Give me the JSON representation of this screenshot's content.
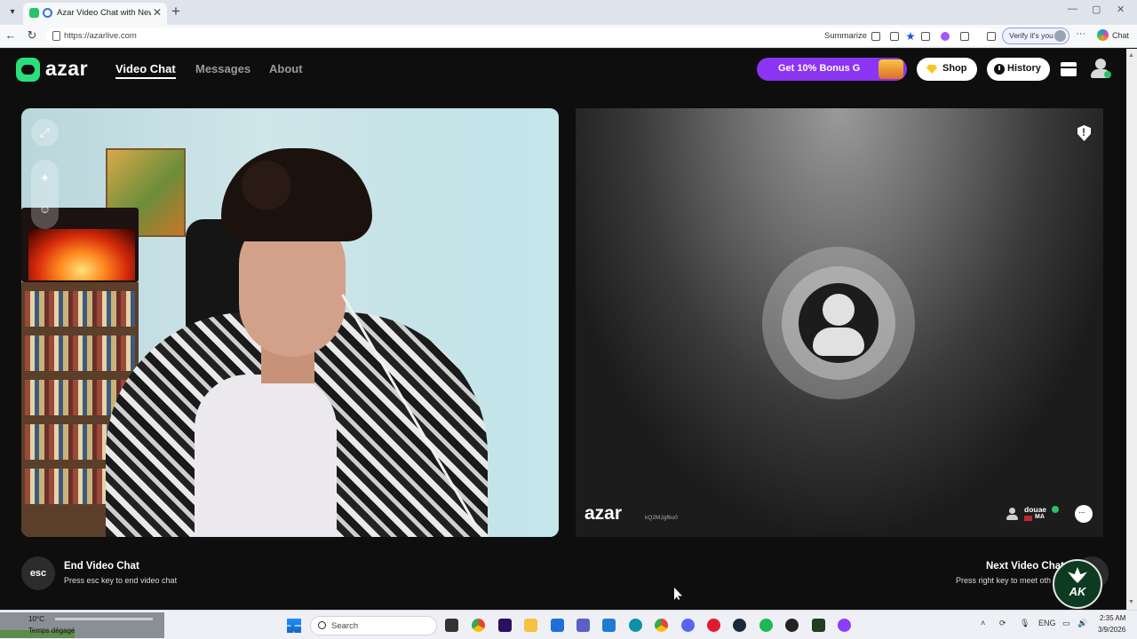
{
  "browser": {
    "tab_title": "Azar Video Chat with New Pe",
    "url": "https://azarlive.com",
    "summarize_label": "Summarize",
    "verify_label": "Verify it's you",
    "chat_label": "Chat"
  },
  "header": {
    "logo_text": "azar",
    "nav": [
      "Video Chat",
      "Messages",
      "About"
    ],
    "bonus_label": "Get 10% Bonus G",
    "shop_label": "Shop",
    "history_label": "History"
  },
  "remote": {
    "logo_text": "azar",
    "session_id": "kQ2MJgf6u0",
    "peer_name": "douae",
    "peer_country": "MA"
  },
  "controls": {
    "esc_key": "esc",
    "end_title": "End Video Chat",
    "end_hint": "Press esc key to end video chat",
    "next_title": "Next Video Chat",
    "next_hint": "Press right key to meet oth"
  },
  "watermark": {
    "text": "AK"
  },
  "taskbar": {
    "weather_temp": "10°C",
    "weather_desc": "Temps dégagé",
    "search_placeholder": "Search",
    "language": "ENG",
    "time": "2:35 AM",
    "date": "3/9/2026"
  },
  "colors": {
    "brand_green": "#29e07a",
    "bonus_purple": "#8b34f2",
    "page_bg": "#0e0e0e"
  }
}
